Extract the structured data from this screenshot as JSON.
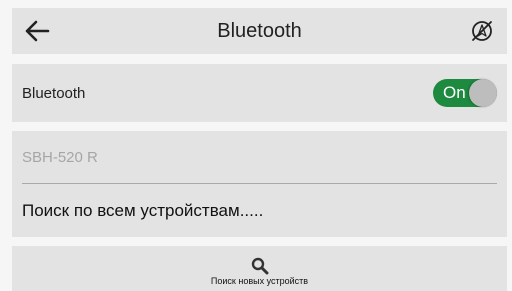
{
  "header": {
    "title": "Bluetooth",
    "back_icon": "arrow-left-icon",
    "right_icon": "location-off-icon"
  },
  "bluetooth_row": {
    "label": "Bluetooth",
    "toggle_state": "On"
  },
  "devices": [
    {
      "name": "SBH-520 R"
    }
  ],
  "search_all_label": "Поиск по всем устройствам.....",
  "scan_button": {
    "icon": "search-icon",
    "label": "Поиск новых устройств"
  },
  "colors": {
    "toggle_on": "#1d8a40",
    "card_bg": "#e3e3e3",
    "page_bg": "#f6f6f6",
    "device_text": "#a6a6a6"
  }
}
